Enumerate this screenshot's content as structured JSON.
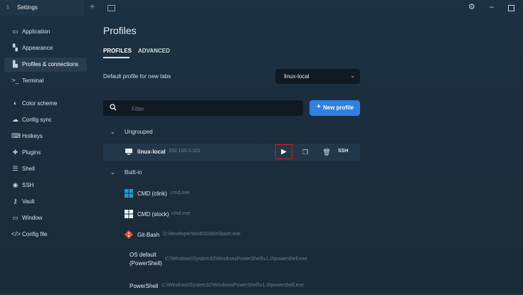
{
  "window": {
    "tab_number": "1",
    "tab_title": "Settings"
  },
  "sidebar": {
    "items": [
      {
        "label": "Application",
        "icon": "window-icon"
      },
      {
        "label": "Appearance",
        "icon": "palette-icon"
      },
      {
        "label": "Profiles & connections",
        "icon": "users-icon"
      },
      {
        "label": "Terminal",
        "icon": "terminal-icon"
      },
      {
        "label": "Color scheme",
        "icon": "color-scheme-icon"
      },
      {
        "label": "Config sync",
        "icon": "cloud-icon"
      },
      {
        "label": "Hotkeys",
        "icon": "keyboard-icon"
      },
      {
        "label": "Plugins",
        "icon": "puzzle-icon"
      },
      {
        "label": "Shell",
        "icon": "list-icon"
      },
      {
        "label": "SSH",
        "icon": "globe-icon"
      },
      {
        "label": "Vault",
        "icon": "key-icon"
      },
      {
        "label": "Window",
        "icon": "window-icon"
      },
      {
        "label": "Config file",
        "icon": "code-icon"
      }
    ],
    "active_index": 2
  },
  "page": {
    "title": "Profiles",
    "tabs": [
      "PROFILES",
      "ADVANCED"
    ],
    "default_profile_label": "Default profile for new tabs",
    "default_profile_value": "linux-local",
    "filter_placeholder": "Filter",
    "new_profile_label": "New profile"
  },
  "groups": [
    {
      "name": "Ungrouped",
      "profiles": [
        {
          "name": "linux-local",
          "path": "192.168.3.101",
          "actions": [
            "play",
            "copy",
            "delete"
          ],
          "badge": "SSH"
        }
      ]
    },
    {
      "name": "Built-in",
      "profiles": [
        {
          "name": "CMD (clink)",
          "path": "cmd.exe"
        },
        {
          "name": "CMD (stock)",
          "path": "cmd.exe"
        },
        {
          "name": "Git-Bash",
          "path": "D:\\developer\\tools\\Git\\bin\\bash.exe"
        },
        {
          "name_line1": "OS default",
          "name_line2": "(PowerShell)",
          "path": "C:\\Windows\\System32\\WindowsPowerShell\\v1.0\\powershell.exe"
        },
        {
          "name": "PowerShell",
          "path": "C:\\Windows\\System32\\WindowsPowerShell\\v1.0\\powershell.exe"
        }
      ]
    }
  ],
  "colors": {
    "accent": "#2f80e0",
    "highlight_border": "#d81b1b",
    "windows_blue": "#1e9bd7",
    "git_orange": "#e8543a"
  }
}
